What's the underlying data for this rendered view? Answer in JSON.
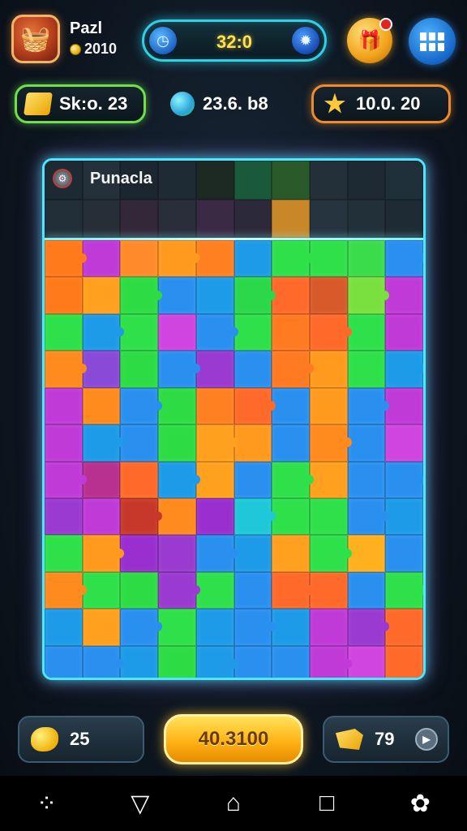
{
  "player": {
    "name": "Pazl",
    "coins": "2010"
  },
  "timer": {
    "value": "32:0"
  },
  "stats": {
    "score": "Sk:o. 23",
    "gems": "23.6. b8",
    "stars": "10.0. 20"
  },
  "board": {
    "title": "Punacla"
  },
  "bottom": {
    "hints": "25",
    "main_button": "40.3100",
    "pieces": "79"
  },
  "colors": {
    "accent_cyan": "#4fe6ff",
    "accent_green": "#6fe04a",
    "accent_orange": "#f08a2a",
    "timer_yellow": "#ffe14a"
  },
  "icons": {
    "avatar": "basket-icon",
    "timer_left": "clock-icon",
    "timer_right": "gear-icon",
    "gift": "gift-icon",
    "menu": "grid-menu-icon",
    "nav": [
      "recent-apps-icon",
      "back-icon",
      "home-icon",
      "overview-icon",
      "assistant-icon"
    ]
  },
  "palette": [
    "#ff8a1e",
    "#ffb01e",
    "#2de04a",
    "#5be43a",
    "#1aa0ff",
    "#2f7de8",
    "#c13ee0",
    "#9a2fd0",
    "#ff6a2a",
    "#1ec8d8"
  ],
  "header_colors": [
    [
      "#1e2a33",
      "#24313b",
      "#1c2630",
      "#1f2b34",
      "#1d2a24",
      "#1a5a3a",
      "#2a5a2a",
      "#232f39",
      "#1e2a33",
      "#20303a"
    ],
    [
      "#222e38",
      "#262f38",
      "#33283a",
      "#2a2d3a",
      "#3a2a44",
      "#2c2a3a",
      "#c8882a",
      "#263440",
      "#22303a",
      "#1e2a34"
    ]
  ],
  "grid_colors": [
    [
      "#ff7a1a",
      "#c03ad8",
      "#ff8a2a",
      "#ff9a1e",
      "#ff8020",
      "#1e9be8",
      "#2ee04a",
      "#2ee04a",
      "#3adc4c",
      "#2a8ff0"
    ],
    [
      "#ff7a1a",
      "#ffa01e",
      "#2ddc44",
      "#2a90f0",
      "#1e9be8",
      "#2ad84a",
      "#ff6a2a",
      "#d85a2a",
      "#7ae040",
      "#c03ad8"
    ],
    [
      "#2ee04a",
      "#1e9be8",
      "#2ee04a",
      "#d044e0",
      "#2a90f0",
      "#2ee04a",
      "#ff7a20",
      "#ff6a2a",
      "#2ee04a",
      "#c03ad8"
    ],
    [
      "#ff8a1e",
      "#8a4ad8",
      "#2ddc44",
      "#2a90f0",
      "#9a3ad0",
      "#2a90f0",
      "#ff7a20",
      "#ff9a1e",
      "#2ee04a",
      "#1e9be8"
    ],
    [
      "#c03ad8",
      "#ff8a1e",
      "#2a90f0",
      "#2ddc44",
      "#ff8020",
      "#ff6a2a",
      "#2a90f0",
      "#ff9a1e",
      "#2a90f0",
      "#c03ad8"
    ],
    [
      "#c03ad8",
      "#1e9be8",
      "#2a90f0",
      "#2ddc44",
      "#ffa01e",
      "#ff9a1e",
      "#2a90f0",
      "#ff8a1e",
      "#2a90f0",
      "#d044e0"
    ],
    [
      "#c03ad8",
      "#b83090",
      "#ff6a2a",
      "#1e9be8",
      "#ffa01e",
      "#2a90f0",
      "#2ee04a",
      "#ffa01e",
      "#2a90f0",
      "#2a90f0"
    ],
    [
      "#9a3ad0",
      "#c03ad8",
      "#c8382a",
      "#ff8a1e",
      "#9a2fd0",
      "#1ec8d8",
      "#2ee04a",
      "#2ee04a",
      "#2a90f0",
      "#1e9be8"
    ],
    [
      "#2ee04a",
      "#ff9a1e",
      "#9a2fd0",
      "#9a3ad0",
      "#2a90f0",
      "#1e9be8",
      "#ffa01e",
      "#2ee04a",
      "#ffb01e",
      "#2a90f0"
    ],
    [
      "#ff8a1e",
      "#2ee04a",
      "#2ddc44",
      "#9a3ad0",
      "#2ee04a",
      "#2a90f0",
      "#ff6a2a",
      "#ff6a2a",
      "#2a90f0",
      "#2ee04a"
    ],
    [
      "#1e9be8",
      "#ffa01e",
      "#2a90f0",
      "#2ee04a",
      "#1e9be8",
      "#2a90f0",
      "#1e9be8",
      "#c03ad8",
      "#9a3ad0",
      "#ff6a2a"
    ],
    [
      "#2a90f0",
      "#2a90f0",
      "#1e9be8",
      "#2ddc44",
      "#1e9be8",
      "#2a90f0",
      "#2a90f0",
      "#c03ad8",
      "#d044e0",
      "#ff6a2a"
    ]
  ]
}
